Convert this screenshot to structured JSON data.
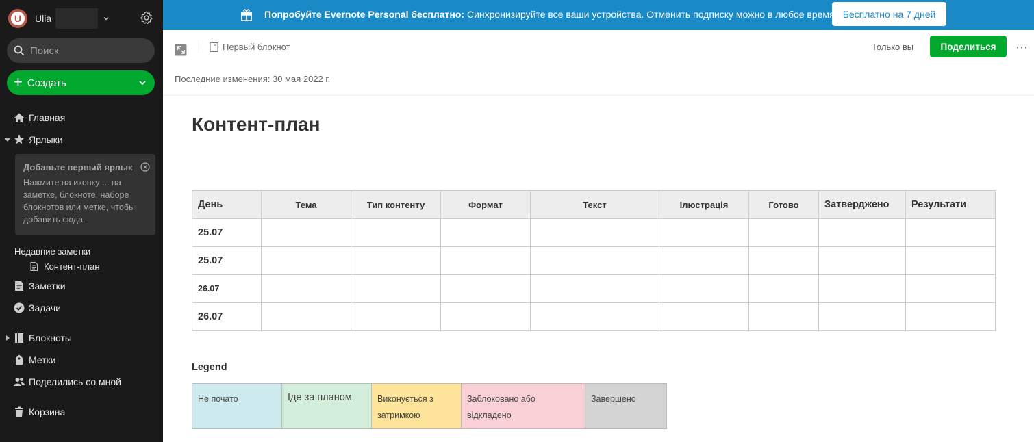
{
  "account": {
    "name": "Ulia",
    "avatar_letter": "U"
  },
  "sidebar": {
    "search_placeholder": "Поиск",
    "create_label": "Создать",
    "nav": {
      "home": "Главная",
      "shortcuts": "Ярлыки",
      "notes": "Заметки",
      "tasks": "Задачи",
      "notebooks": "Блокноты",
      "tags": "Метки",
      "shared": "Поделились со мной",
      "trash": "Корзина"
    },
    "tip": {
      "title": "Добавьте первый ярлык",
      "text": "Нажмите на иконку ... на заметке, блокноте, наборе блокнотов или метке, чтобы добавить сюда."
    },
    "recent": {
      "title": "Недавние заметки",
      "items": [
        "Контент-план"
      ]
    }
  },
  "banner": {
    "bold": "Попробуйте Evernote Personal бесплатно:",
    "text": " Синхронизируйте все ваши устройства. Отменить подписку можно в любое время.",
    "button": "Бесплатно на 7 дней"
  },
  "toolbar": {
    "notebook": "Первый блокнот",
    "visibility": "Только вы",
    "share_button": "Поделиться",
    "last_changed": "Последние изменения: 30 мая 2022 г."
  },
  "note": {
    "title": "Контент-план",
    "table": {
      "headers": [
        "День",
        "Тема",
        "Тип контенту",
        "Формат",
        "Текст",
        "Ілюстрація",
        "Готово",
        "Затверджено",
        "Результати"
      ],
      "rows": [
        [
          "25.07",
          "",
          "",
          "",
          "",
          "",
          "",
          "",
          ""
        ],
        [
          "25.07",
          "",
          "",
          "",
          "",
          "",
          "",
          "",
          ""
        ],
        [
          "26.07",
          "",
          "",
          "",
          "",
          "",
          "",
          "",
          ""
        ],
        [
          "26.07",
          "",
          "",
          "",
          "",
          "",
          "",
          "",
          ""
        ]
      ]
    },
    "legend": {
      "title": "Legend",
      "items": [
        {
          "label": "Не почато",
          "color": "#cdebee"
        },
        {
          "label": "Іде за планом",
          "color": "#d4eedc"
        },
        {
          "label": "Виконується з затримкою",
          "color": "#fde49a"
        },
        {
          "label": "Заблоковано або відкладено",
          "color": "#f9d0d6"
        },
        {
          "label": "Завершено",
          "color": "#d4d4d4"
        }
      ]
    }
  },
  "colors": {
    "sidebar_bg": "#1a1a1a",
    "accent_green": "#00a82d",
    "banner_blue": "#1a8ac6"
  }
}
